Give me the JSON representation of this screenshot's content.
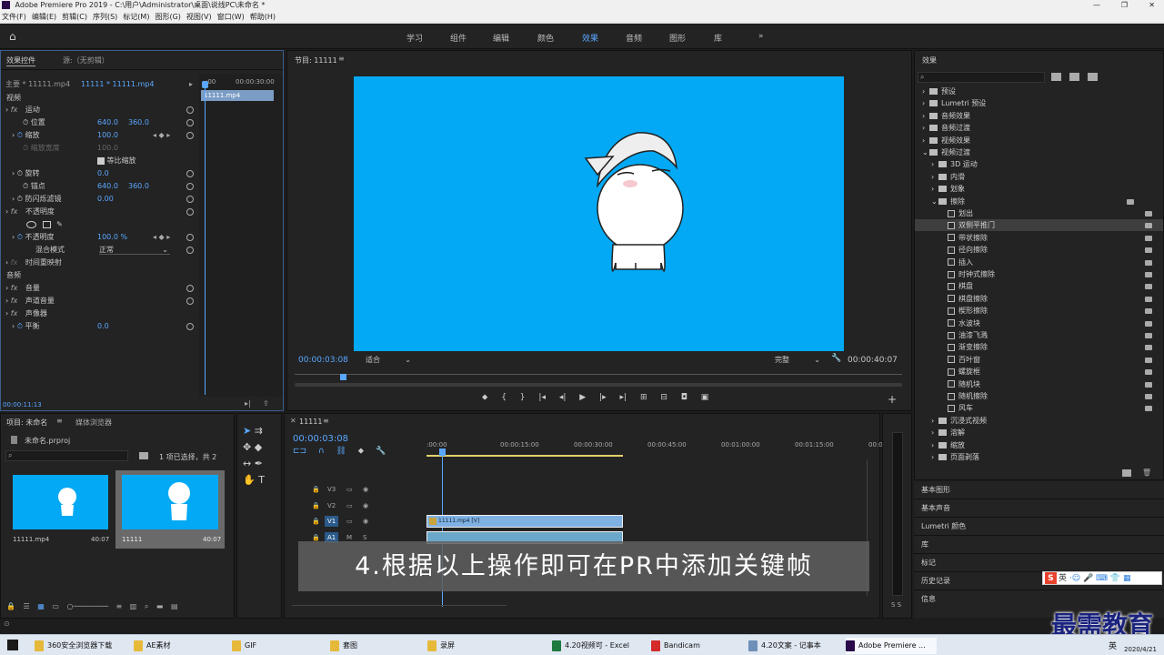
{
  "app": {
    "title": "Adobe Premiere Pro 2019 - C:\\用户\\Administrator\\桌面\\说线PC\\未命名 *"
  },
  "menu": [
    "文件(F)",
    "编辑(E)",
    "剪辑(C)",
    "序列(S)",
    "标记(M)",
    "图形(G)",
    "视图(V)",
    "窗口(W)",
    "帮助(H)"
  ],
  "workspaces": {
    "items": [
      "学习",
      "组件",
      "编辑",
      "颜色",
      "效果",
      "音频",
      "图形",
      "库"
    ],
    "more": "»"
  },
  "effect_controls": {
    "tab_active": "效果控件",
    "tab_source": "源:（无剪辑）",
    "master": "主要 * 11111.mp4",
    "clip": "11111 * 11111.mp4",
    "ruler_start": ":00",
    "ruler_end": "00:00:30:00",
    "clip_name": "11111.mp4",
    "sections": {
      "video": "视频",
      "audio": "音频"
    },
    "rows": {
      "motion": "运动",
      "position": {
        "label": "位置",
        "x": "640.0",
        "y": "360.0"
      },
      "scale": {
        "label": "缩放",
        "value": "100.0"
      },
      "scale_width": {
        "label": "缩放宽度",
        "value": "100.0"
      },
      "uniform": "等比缩放",
      "rotation": {
        "label": "旋转",
        "value": "0.0"
      },
      "anchor": {
        "label": "锚点",
        "x": "640.0",
        "y": "360.0"
      },
      "flicker": {
        "label": "防闪烁滤镜",
        "value": "0.00"
      },
      "opacity_group": "不透明度",
      "opacity": {
        "label": "不透明度",
        "value": "100.0 %"
      },
      "blend": {
        "label": "混合模式",
        "value": "正常"
      },
      "time_remap": "时间重映射",
      "volume": "音量",
      "channel_volume": "声道音量",
      "panner": "声像器",
      "balance": {
        "label": "平衡",
        "value": "0.0"
      }
    },
    "timecode": "00:00:11:13"
  },
  "program": {
    "title": "节目: 11111",
    "timecode": "00:00:03:08",
    "fit": "适合",
    "quality": "完整",
    "duration": "00:00:40:07"
  },
  "effects": {
    "title": "效果",
    "tree": [
      {
        "label": "预设",
        "level": 0,
        "type": "folder",
        "open": false
      },
      {
        "label": "Lumetri 预设",
        "level": 0,
        "type": "folder",
        "open": false
      },
      {
        "label": "音频效果",
        "level": 0,
        "type": "folder",
        "open": false
      },
      {
        "label": "音频过渡",
        "level": 0,
        "type": "folder",
        "open": false
      },
      {
        "label": "视频效果",
        "level": 0,
        "type": "folder",
        "open": false
      },
      {
        "label": "视频过渡",
        "level": 0,
        "type": "folder",
        "open": true
      },
      {
        "label": "3D 运动",
        "level": 1,
        "type": "folder",
        "open": false
      },
      {
        "label": "内滑",
        "level": 1,
        "type": "folder",
        "open": false
      },
      {
        "label": "划象",
        "level": 1,
        "type": "folder",
        "open": false
      },
      {
        "label": "擦除",
        "level": 1,
        "type": "folder",
        "open": true
      },
      {
        "label": "划出",
        "level": 2,
        "type": "item"
      },
      {
        "label": "双侧平推门",
        "level": 2,
        "type": "item",
        "selected": true
      },
      {
        "label": "带状擦除",
        "level": 2,
        "type": "item"
      },
      {
        "label": "径向擦除",
        "level": 2,
        "type": "item"
      },
      {
        "label": "插入",
        "level": 2,
        "type": "item"
      },
      {
        "label": "时钟式擦除",
        "level": 2,
        "type": "item"
      },
      {
        "label": "棋盘",
        "level": 2,
        "type": "item"
      },
      {
        "label": "棋盘擦除",
        "level": 2,
        "type": "item"
      },
      {
        "label": "楔形擦除",
        "level": 2,
        "type": "item"
      },
      {
        "label": "水波块",
        "level": 2,
        "type": "item"
      },
      {
        "label": "油漆飞溅",
        "level": 2,
        "type": "item"
      },
      {
        "label": "渐变擦除",
        "level": 2,
        "type": "item"
      },
      {
        "label": "百叶窗",
        "level": 2,
        "type": "item"
      },
      {
        "label": "螺旋框",
        "level": 2,
        "type": "item"
      },
      {
        "label": "随机块",
        "level": 2,
        "type": "item"
      },
      {
        "label": "随机擦除",
        "level": 2,
        "type": "item"
      },
      {
        "label": "风车",
        "level": 2,
        "type": "item"
      },
      {
        "label": "沉浸式视频",
        "level": 1,
        "type": "folder",
        "open": false
      },
      {
        "label": "溶解",
        "level": 1,
        "type": "folder",
        "open": false
      },
      {
        "label": "缩放",
        "level": 1,
        "type": "folder",
        "open": false
      },
      {
        "label": "页面剥落",
        "level": 1,
        "type": "folder",
        "open": false
      }
    ],
    "bottom_panels": [
      "基本图形",
      "基本声音",
      "Lumetri 颜色",
      "库",
      "标记",
      "历史记录",
      "信息"
    ]
  },
  "project": {
    "tab_active": "项目: 未命名",
    "tab_media": "媒体浏览器",
    "file": "未命名.prproj",
    "selection": "1 项已选择，共 2",
    "items": [
      {
        "name": "11111.mp4",
        "duration": "40:07"
      },
      {
        "name": "11111",
        "duration": "40:07"
      }
    ]
  },
  "timeline": {
    "title": "11111",
    "timecode": "00:00:03:08",
    "ruler": [
      ":00:00",
      "00:00:15:00",
      "00:00:30:00",
      "00:00:45:00",
      "00:01:00:00",
      "00:01:15:00",
      "00:0"
    ],
    "tracks": [
      "V3",
      "V2",
      "V1",
      "A1"
    ],
    "clip_label": "11111.mp4 [V]"
  },
  "subtitle": "4.根据以上操作即可在PR中添加关键帧",
  "ime": {
    "label": "英"
  },
  "watermark": "最需教育",
  "taskbar": {
    "items": [
      "360安全浏览器下载",
      "AE素材",
      "GIF",
      "套图",
      "录屏",
      "4.20视频可 - Excel",
      "Bandicam",
      "4.20文案 - 记事本",
      "Adobe Premiere ..."
    ],
    "lang": "英",
    "date": "2020/4/21"
  },
  "colors": {
    "accent": "#5aa7ff",
    "video_bg": "#03a9f4",
    "clip": "#7fb1e3"
  }
}
